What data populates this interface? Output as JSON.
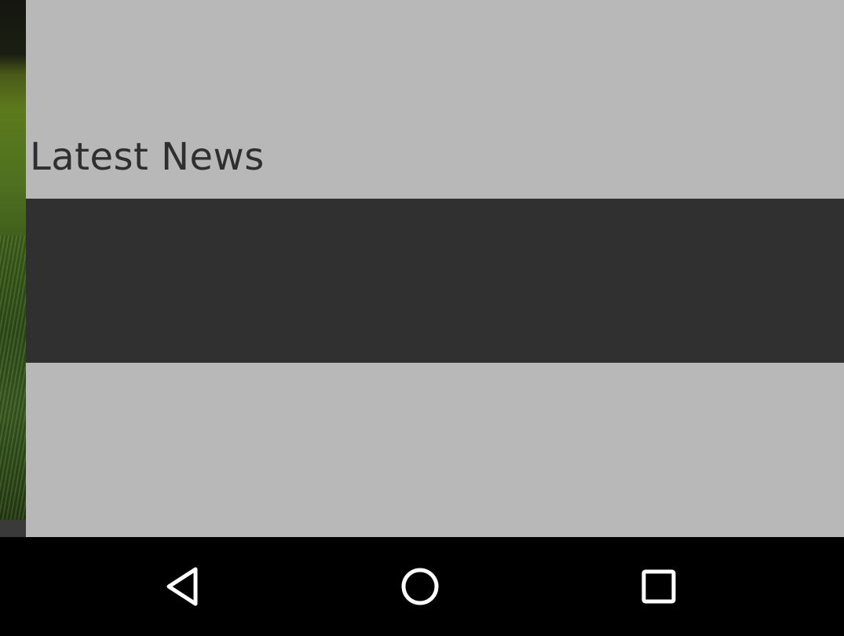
{
  "main": {
    "section_title": "Latest News"
  },
  "navigation_bar": {
    "buttons": [
      {
        "name": "back",
        "icon": "back-triangle-icon"
      },
      {
        "name": "home",
        "icon": "home-circle-icon"
      },
      {
        "name": "recents",
        "icon": "recents-square-icon"
      }
    ]
  },
  "colors": {
    "panel_background": "#b8b8b8",
    "news_band": "#303030",
    "title_text": "#2f2f2f",
    "nav_bar": "#000000",
    "nav_icon": "#ffffff"
  }
}
